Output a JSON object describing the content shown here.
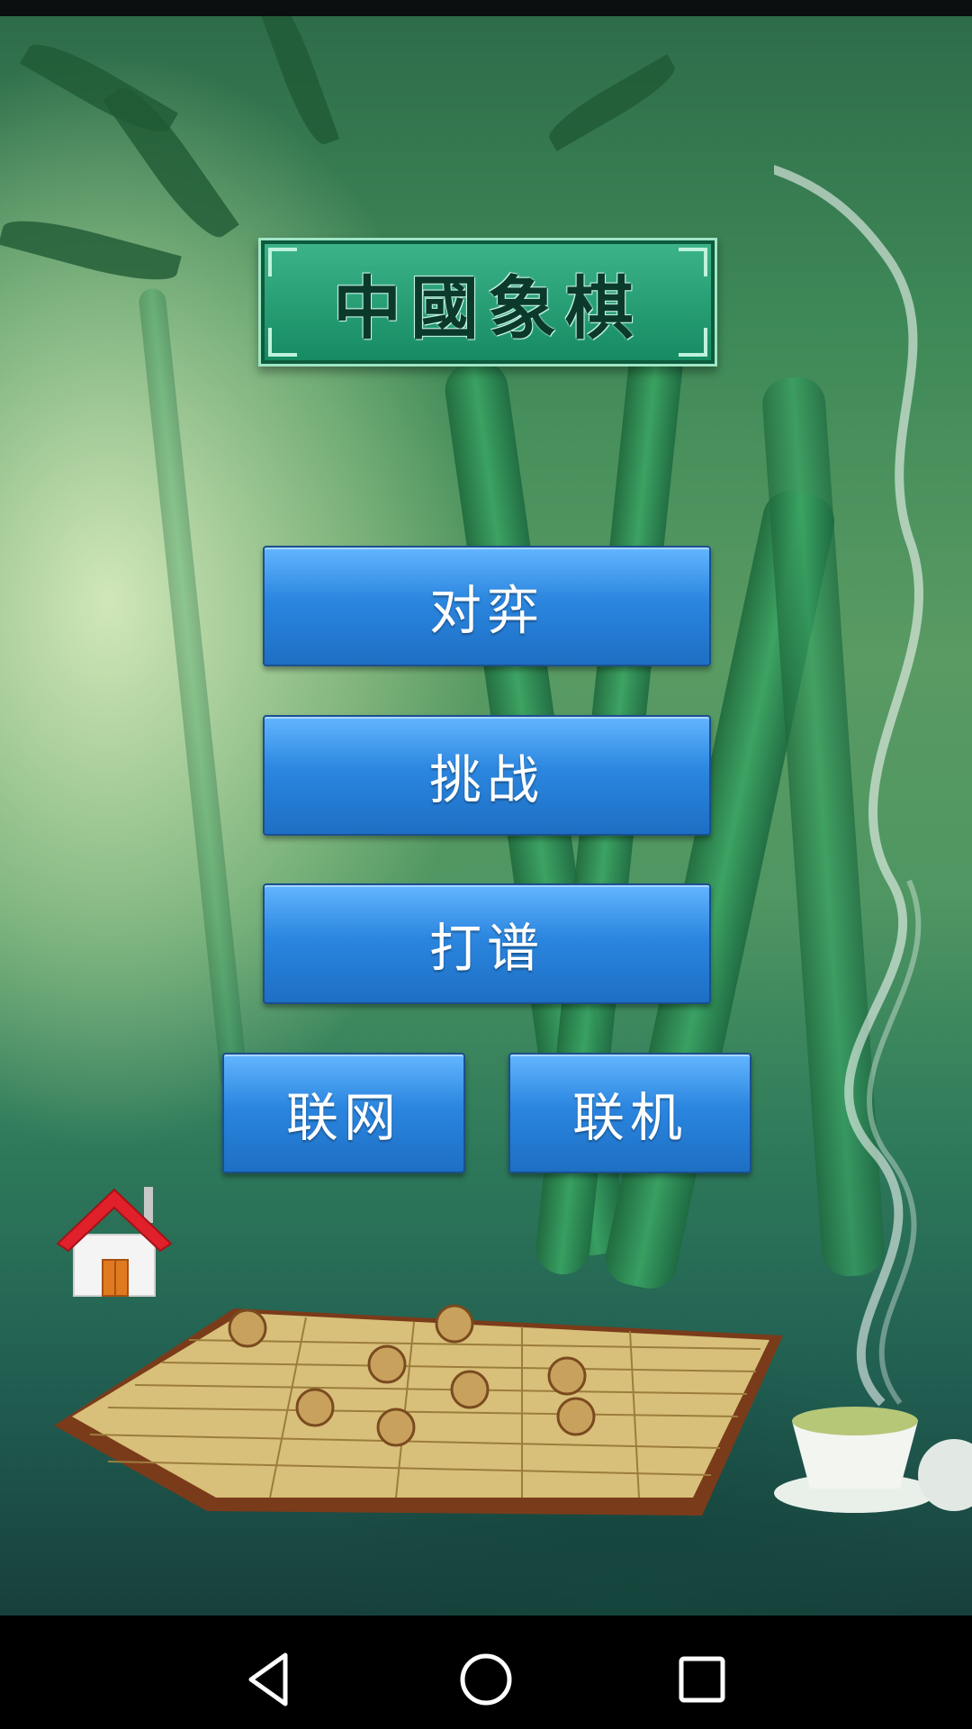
{
  "title": "中國象棋",
  "menu": {
    "duiyi": "对弈",
    "tiaozhan": "挑战",
    "dapu": "打谱",
    "lianwang": "联网",
    "lianji": "联机"
  },
  "colors": {
    "button_top": "#63b6ff",
    "button_bottom": "#1d6fc4",
    "title_bg": "#158a62"
  },
  "icons": {
    "home": "home-icon",
    "back": "back-triangle-icon",
    "home_nav": "home-circle-icon",
    "recents": "recents-square-icon"
  }
}
